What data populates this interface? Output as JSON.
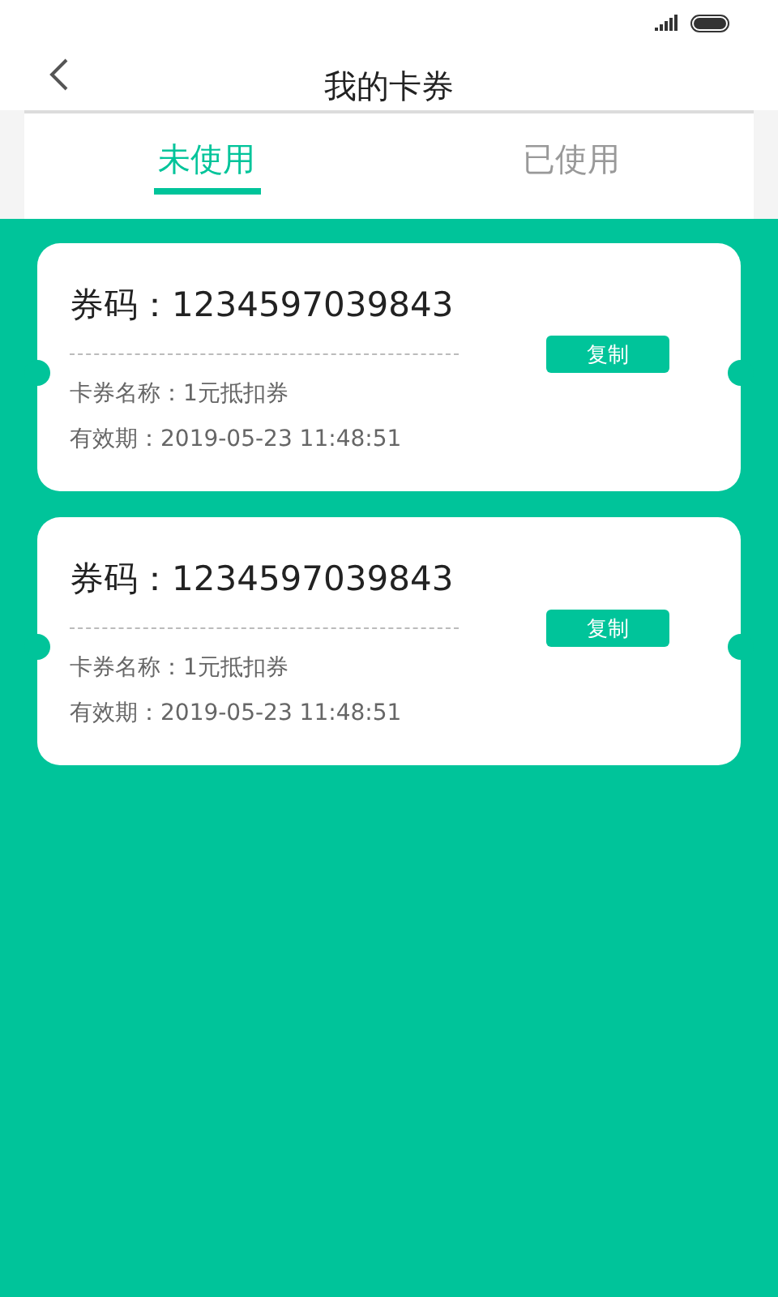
{
  "header": {
    "title": "我的卡券"
  },
  "tabs": [
    {
      "label": "未使用",
      "selected": true
    },
    {
      "label": "已使用",
      "selected": false
    }
  ],
  "coupons": [
    {
      "code_label": "券码：",
      "code": "1234597039843",
      "name": "卡券名称：1元抵扣券",
      "expiry": "有效期：2019-05-23 11:48:51",
      "action": "复制"
    },
    {
      "code_label": "券码：",
      "code": "1234597039843",
      "name": "卡券名称：1元抵扣券",
      "expiry": "有效期：2019-05-23 11:48:51",
      "action": "复制"
    }
  ]
}
